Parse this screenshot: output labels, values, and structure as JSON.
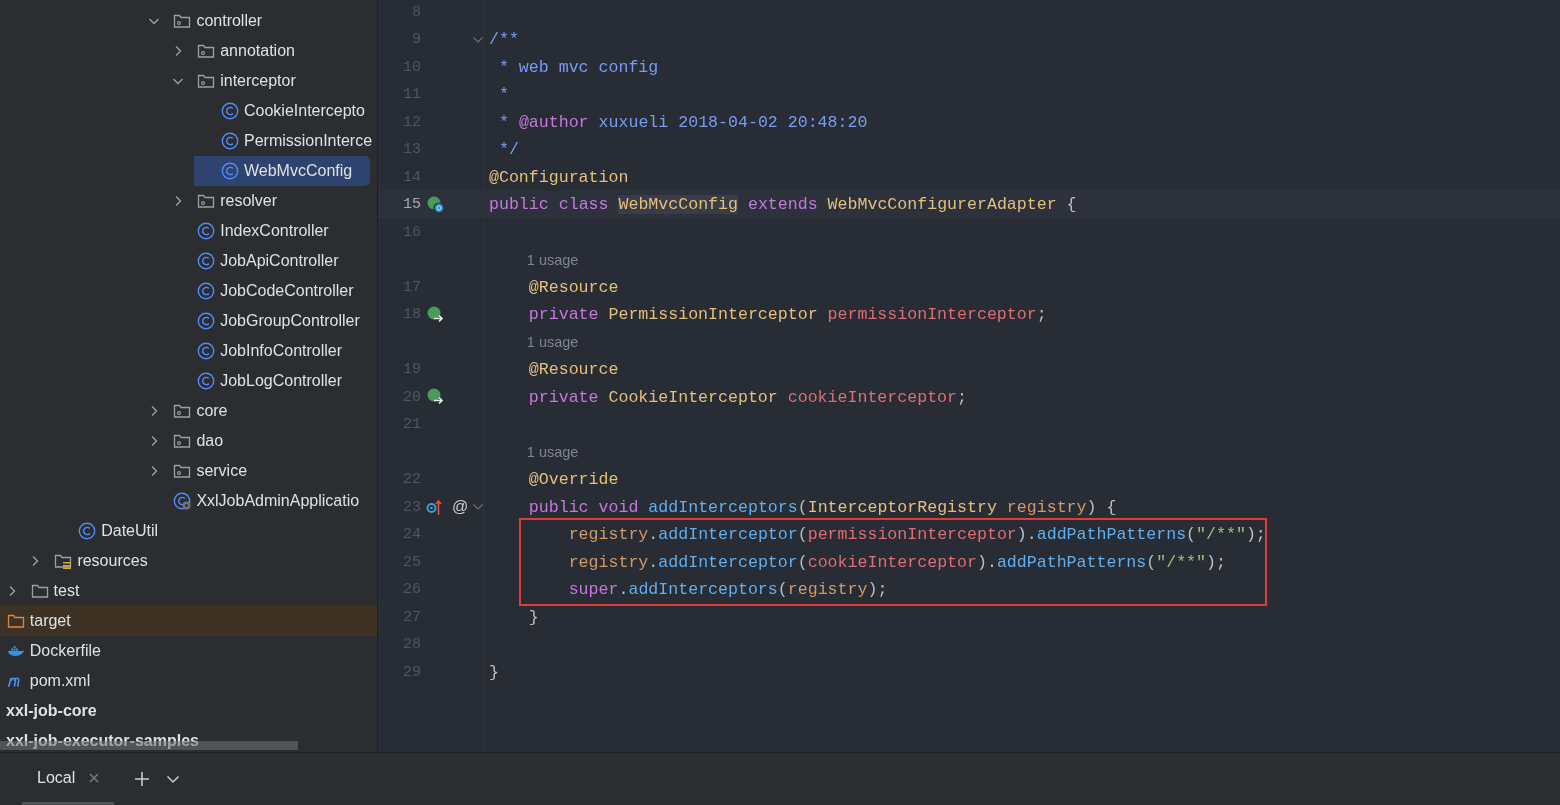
{
  "project_tree": [
    {
      "children": [
        {
          "children": [
            {
              "children": [
                {
                  "children": [
                    {
                      "children": [
                        {
                          "children": [
                            {
                              "children": [
                                {
                                  "children": [
                                    {
                                      "label": "controller",
                                      "kind": "package",
                                      "expanded": true,
                                      "selected": false,
                                      "children": [
                                        {
                                          "label": "annotation",
                                          "kind": "package",
                                          "expanded": false,
                                          "selected": false
                                        },
                                        {
                                          "label": "interceptor",
                                          "kind": "package",
                                          "expanded": true,
                                          "selected": false,
                                          "children": [
                                            {
                                              "label": "CookieIntercepto",
                                              "kind": "class",
                                              "selected": false
                                            },
                                            {
                                              "label": "PermissionInterce",
                                              "kind": "class",
                                              "selected": false
                                            },
                                            {
                                              "label": "WebMvcConfig",
                                              "kind": "class",
                                              "selected": true
                                            }
                                          ]
                                        },
                                        {
                                          "label": "resolver",
                                          "kind": "package",
                                          "expanded": false,
                                          "selected": false
                                        },
                                        {
                                          "label": "IndexController",
                                          "kind": "class",
                                          "selected": false
                                        },
                                        {
                                          "label": "JobApiController",
                                          "kind": "class",
                                          "selected": false
                                        },
                                        {
                                          "label": "JobCodeController",
                                          "kind": "class",
                                          "selected": false
                                        },
                                        {
                                          "label": "JobGroupController",
                                          "kind": "class",
                                          "selected": false
                                        },
                                        {
                                          "label": "JobInfoController",
                                          "kind": "class",
                                          "selected": false
                                        },
                                        {
                                          "label": "JobLogController",
                                          "kind": "class",
                                          "selected": false
                                        }
                                      ]
                                    },
                                    {
                                      "label": "core",
                                      "kind": "package",
                                      "expanded": false,
                                      "selected": false
                                    },
                                    {
                                      "label": "dao",
                                      "kind": "package",
                                      "expanded": false,
                                      "selected": false
                                    },
                                    {
                                      "label": "service",
                                      "kind": "package",
                                      "expanded": false,
                                      "selected": false
                                    },
                                    {
                                      "label": "XxlJobAdminApplicatio",
                                      "kind": "app-class",
                                      "selected": false
                                    }
                                  ]
                                }
                              ]
                            }
                          ]
                        }
                      ]
                    },
                    {
                      "label": "DateUtil",
                      "kind": "class",
                      "selected": false
                    }
                  ]
                },
                {
                  "label": "resources",
                  "kind": "resources",
                  "expanded": false,
                  "selected": false
                }
              ]
            },
            {
              "label": "test",
              "kind": "folder",
              "expanded": false,
              "selected": false
            }
          ]
        },
        {
          "label": "target",
          "kind": "excluded",
          "selected": false
        },
        {
          "label": "Dockerfile",
          "kind": "docker",
          "selected": false
        },
        {
          "label": "pom.xml",
          "kind": "maven",
          "selected": false
        }
      ]
    },
    {
      "label": "xxl-job-core",
      "kind": "module",
      "selected": false
    },
    {
      "label": "xxl-job-executor-samples",
      "kind": "module",
      "selected": false
    }
  ],
  "code": {
    "lines": [
      {
        "kind": "code",
        "number": "8",
        "current": false,
        "boxed": false
      },
      {
        "kind": "code",
        "number": "9",
        "current": false,
        "boxed": false,
        "foldable": true,
        "tokens": [
          {
            "text": "/**",
            "kind": "doc"
          }
        ]
      },
      {
        "kind": "code",
        "number": "10",
        "current": false,
        "boxed": false,
        "tokens": [
          {
            "text": " * web mvc config",
            "kind": "doc"
          }
        ]
      },
      {
        "kind": "code",
        "number": "11",
        "current": false,
        "boxed": false,
        "tokens": [
          {
            "text": " *",
            "kind": "doc"
          }
        ]
      },
      {
        "kind": "code",
        "number": "12",
        "current": false,
        "boxed": false,
        "tokens": [
          {
            "text": " * ",
            "kind": "doc"
          },
          {
            "text": "@author",
            "kind": "doc-tag"
          },
          {
            "text": " xuxueli 2018-04-02 20:48:20",
            "kind": "doc"
          }
        ]
      },
      {
        "kind": "code",
        "number": "13",
        "current": false,
        "boxed": false,
        "tokens": [
          {
            "text": " */",
            "kind": "doc"
          }
        ]
      },
      {
        "kind": "code",
        "number": "14",
        "current": false,
        "boxed": false,
        "tokens": [
          {
            "text": "@Configuration",
            "kind": "annotation"
          }
        ]
      },
      {
        "kind": "code",
        "number": "15",
        "current": true,
        "boxed": false,
        "gutter_icon": {
          "kind": "class-bean"
        },
        "tokens": [
          {
            "text": "public ",
            "kind": "keyword"
          },
          {
            "text": "class ",
            "kind": "keyword"
          },
          {
            "text": "WebMvcConfig",
            "kind": "type",
            "highlighted": true
          },
          {
            "text": " extends ",
            "kind": "keyword"
          },
          {
            "text": "WebMvcConfigurerAdapter",
            "kind": "type"
          },
          {
            "text": " {",
            "kind": "plain"
          }
        ]
      },
      {
        "kind": "code",
        "number": "16",
        "current": false,
        "boxed": false
      },
      {
        "kind": "usage",
        "text": "1 usage"
      },
      {
        "kind": "code",
        "number": "17",
        "current": false,
        "boxed": false,
        "tokens": [
          {
            "text": "    @Resource",
            "kind": "annotation"
          }
        ]
      },
      {
        "kind": "code",
        "number": "18",
        "current": false,
        "boxed": false,
        "gutter_icon": {
          "kind": "inject"
        },
        "tokens": [
          {
            "text": "    private ",
            "kind": "keyword"
          },
          {
            "text": "PermissionInterceptor ",
            "kind": "type"
          },
          {
            "text": "permissionInterceptor",
            "kind": "field"
          },
          {
            "text": ";",
            "kind": "plain"
          }
        ]
      },
      {
        "kind": "usage",
        "text": "1 usage"
      },
      {
        "kind": "code",
        "number": "19",
        "current": false,
        "boxed": false,
        "tokens": [
          {
            "text": "    @Resource",
            "kind": "annotation"
          }
        ]
      },
      {
        "kind": "code",
        "number": "20",
        "current": false,
        "boxed": false,
        "gutter_icon": {
          "kind": "inject"
        },
        "tokens": [
          {
            "text": "    private ",
            "kind": "keyword"
          },
          {
            "text": "CookieInterceptor ",
            "kind": "type"
          },
          {
            "text": "cookieInterceptor",
            "kind": "field"
          },
          {
            "text": ";",
            "kind": "plain"
          }
        ]
      },
      {
        "kind": "code",
        "number": "21",
        "current": false,
        "boxed": false
      },
      {
        "kind": "usage",
        "text": "1 usage"
      },
      {
        "kind": "code",
        "number": "22",
        "current": false,
        "boxed": false,
        "tokens": [
          {
            "text": "    @Override",
            "kind": "annotation"
          }
        ]
      },
      {
        "kind": "code",
        "number": "23",
        "current": false,
        "boxed": false,
        "gutter_icon": {
          "kind": "override"
        },
        "symbol": "@",
        "foldable": true,
        "tokens": [
          {
            "text": "    public ",
            "kind": "keyword"
          },
          {
            "text": "void ",
            "kind": "keyword"
          },
          {
            "text": "addInterceptors",
            "kind": "method"
          },
          {
            "text": "(",
            "kind": "plain"
          },
          {
            "text": "InterceptorRegistry ",
            "kind": "type"
          },
          {
            "text": "registry",
            "kind": "param"
          },
          {
            "text": ") {",
            "kind": "plain"
          }
        ]
      },
      {
        "kind": "code",
        "number": "24",
        "current": false,
        "boxed": true,
        "tokens": [
          {
            "text": "        registry",
            "kind": "param"
          },
          {
            "text": ".",
            "kind": "plain"
          },
          {
            "text": "addInterceptor",
            "kind": "method"
          },
          {
            "text": "(",
            "kind": "plain"
          },
          {
            "text": "permissionInterceptor",
            "kind": "field"
          },
          {
            "text": ").",
            "kind": "plain"
          },
          {
            "text": "addPathPatterns",
            "kind": "method"
          },
          {
            "text": "(",
            "kind": "plain"
          },
          {
            "text": "\"/**\"",
            "kind": "string"
          },
          {
            "text": ");",
            "kind": "plain"
          }
        ]
      },
      {
        "kind": "code",
        "number": "25",
        "current": false,
        "boxed": true,
        "tokens": [
          {
            "text": "        registry",
            "kind": "param"
          },
          {
            "text": ".",
            "kind": "plain"
          },
          {
            "text": "addInterceptor",
            "kind": "method"
          },
          {
            "text": "(",
            "kind": "plain"
          },
          {
            "text": "cookieInterceptor",
            "kind": "field"
          },
          {
            "text": ").",
            "kind": "plain"
          },
          {
            "text": "addPathPatterns",
            "kind": "method"
          },
          {
            "text": "(",
            "kind": "plain"
          },
          {
            "text": "\"/**\"",
            "kind": "string"
          },
          {
            "text": ");",
            "kind": "plain"
          }
        ]
      },
      {
        "kind": "code",
        "number": "26",
        "current": false,
        "boxed": true,
        "tokens": [
          {
            "text": "        super",
            "kind": "keyword"
          },
          {
            "text": ".",
            "kind": "plain"
          },
          {
            "text": "addInterceptors",
            "kind": "method"
          },
          {
            "text": "(",
            "kind": "plain"
          },
          {
            "text": "registry",
            "kind": "param"
          },
          {
            "text": ");",
            "kind": "plain"
          }
        ]
      },
      {
        "kind": "code",
        "number": "27",
        "current": false,
        "boxed": false,
        "tokens": [
          {
            "text": "    }",
            "kind": "plain"
          }
        ]
      },
      {
        "kind": "code",
        "number": "28",
        "current": false,
        "boxed": false
      },
      {
        "kind": "code",
        "number": "29",
        "current": false,
        "boxed": false,
        "tokens": [
          {
            "text": "}",
            "kind": "plain"
          }
        ]
      }
    ]
  },
  "terminal": {
    "tabs": [
      {
        "label": "Local",
        "selected": true
      }
    ]
  }
}
